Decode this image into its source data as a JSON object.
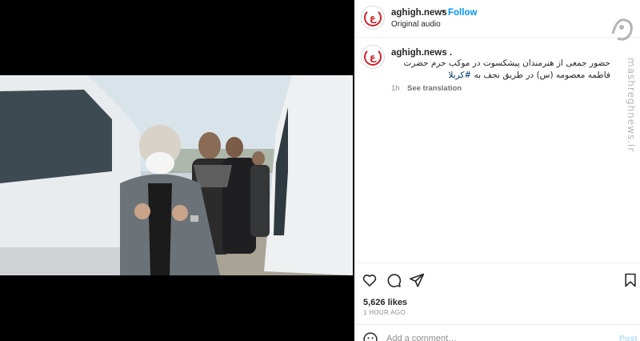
{
  "post": {
    "username": "aghigh.news",
    "separator": "•",
    "follow_label": "Follow",
    "audio_label": "Original audio"
  },
  "caption": {
    "username": "aghigh.news .",
    "text": "حضور جمعی از هنرمندان پیشکسوت در موکب حرم حضرت فاطمه معصومه (س) در طریق نجف به",
    "hashtag": "#کربلا",
    "time": "1h",
    "see_translation": "See translation"
  },
  "engagement": {
    "likes": "5,626 likes",
    "age": "1 HOUR AGO"
  },
  "comment_box": {
    "placeholder": "Add a comment…",
    "post_label": "Post"
  },
  "watermark": {
    "text": "mashreghnews.ir"
  },
  "icons": {
    "like": "heart-icon",
    "comment": "comment-bubble-icon",
    "share": "paper-plane-icon",
    "save": "bookmark-icon",
    "emoji": "smiley-icon",
    "mute": "speaker-icon"
  },
  "colors": {
    "follow_blue": "#0095f6",
    "brand_red": "#d2202a",
    "text": "#262626",
    "muted": "#8e8e8e"
  }
}
